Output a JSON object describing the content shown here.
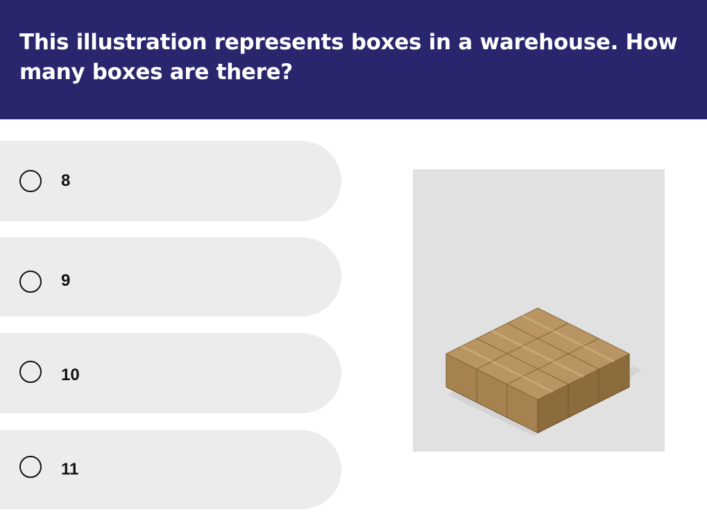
{
  "question": {
    "text": "This illustration represents boxes in a warehouse. How many boxes are there?"
  },
  "options": [
    {
      "label": "8"
    },
    {
      "label": "9"
    },
    {
      "label": "10"
    },
    {
      "label": "11"
    }
  ],
  "figure": {
    "icon": "boxes-illustration",
    "background_color": "#e1e1e1"
  },
  "colors": {
    "header_bg": "#2a266d",
    "option_bg": "#ececec",
    "box_top": "#b89562",
    "box_left": "#a5824f",
    "box_right": "#8c6b3d"
  }
}
